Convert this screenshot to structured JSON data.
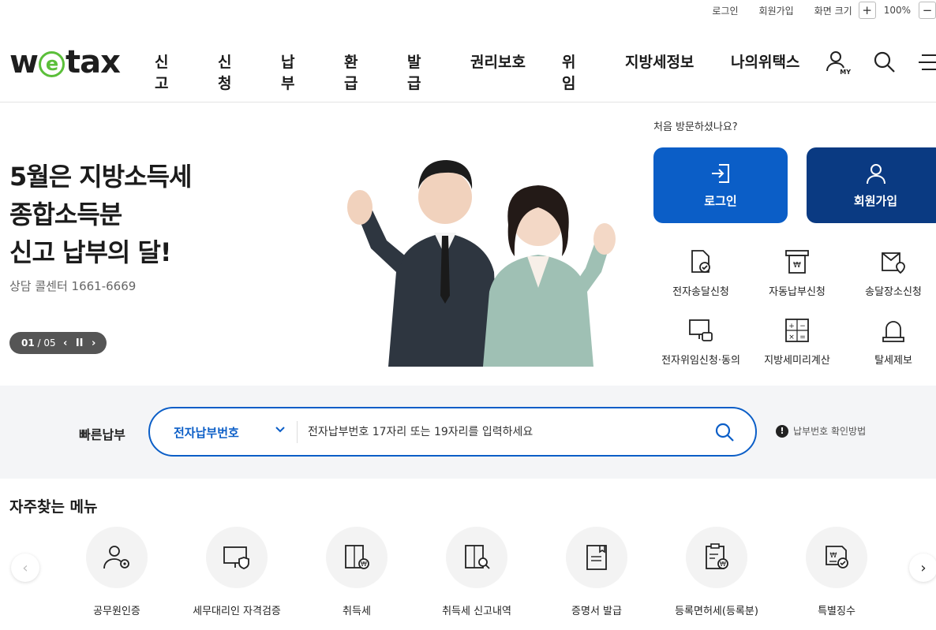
{
  "util": {
    "login": "로그인",
    "join": "회원가입",
    "zoom_label": "화면 크기",
    "zoom_in": "+",
    "zoom_value": "100%",
    "zoom_out": "−"
  },
  "logo": {
    "pre": "w",
    "e": "e",
    "post": "tax"
  },
  "gnb": [
    "신고",
    "신청",
    "납부",
    "환급",
    "발급",
    "권리보호",
    "위임",
    "지방세정보",
    "나의위택스"
  ],
  "header_icons": [
    "my-icon",
    "search-icon",
    "menu-icon"
  ],
  "my_icon_text": "MY",
  "hero": {
    "title_lines": [
      "5월은 지방소득세",
      "종합소득분",
      "신고 납부의 달!"
    ],
    "sub": "상담 콜센터 1661-6669",
    "pager_current": "01",
    "pager_total": "/ 05",
    "prev": "‹",
    "pause": "II",
    "next": "›"
  },
  "side": {
    "first_visit": "처음 방문하셨나요?",
    "login_btn": "로그인",
    "join_btn": "회원가입",
    "services": [
      "전자송달신청",
      "자동납부신청",
      "송달장소신청",
      "전자위임신청·동의",
      "지방세미리계산",
      "탈세제보"
    ]
  },
  "quick_pay": {
    "label": "빠른납부",
    "selected": "전자납부번호",
    "placeholder": "전자납부번호 17자리 또는 19자리를 입력하세요",
    "help": "납부번호 확인방법",
    "help_mark": "!"
  },
  "favorites": {
    "title": "자주찾는 메뉴",
    "items": [
      "공무원인증",
      "세무대리인 자격검증",
      "취득세",
      "취득세 신고내역",
      "증명서 발급",
      "등록면허세(등록분)",
      "특별징수"
    ]
  },
  "colors": {
    "primary": "#0b5ec7",
    "dark_blue": "#0a3a82",
    "logo_green": "#5bbf3a"
  }
}
